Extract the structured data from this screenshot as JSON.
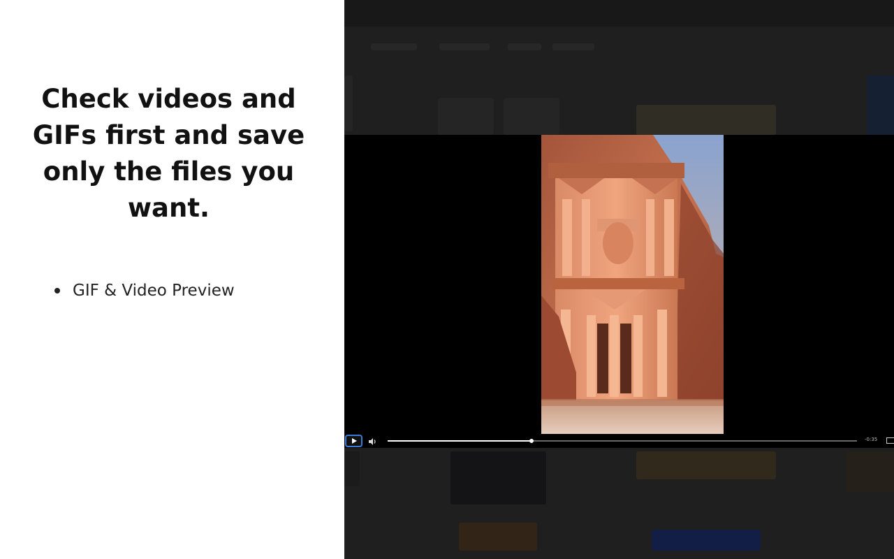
{
  "slide": {
    "headline": "Check videos and GIFs first and save only the files you want.",
    "features": [
      "GIF & Video Preview"
    ]
  },
  "player": {
    "remaining_time": "-0:35",
    "progress": 0.307,
    "icons": {
      "play": "play-icon",
      "volume": "volume-icon",
      "pip": "picture-in-picture-icon"
    },
    "accent_color": "#3a7bd5"
  }
}
